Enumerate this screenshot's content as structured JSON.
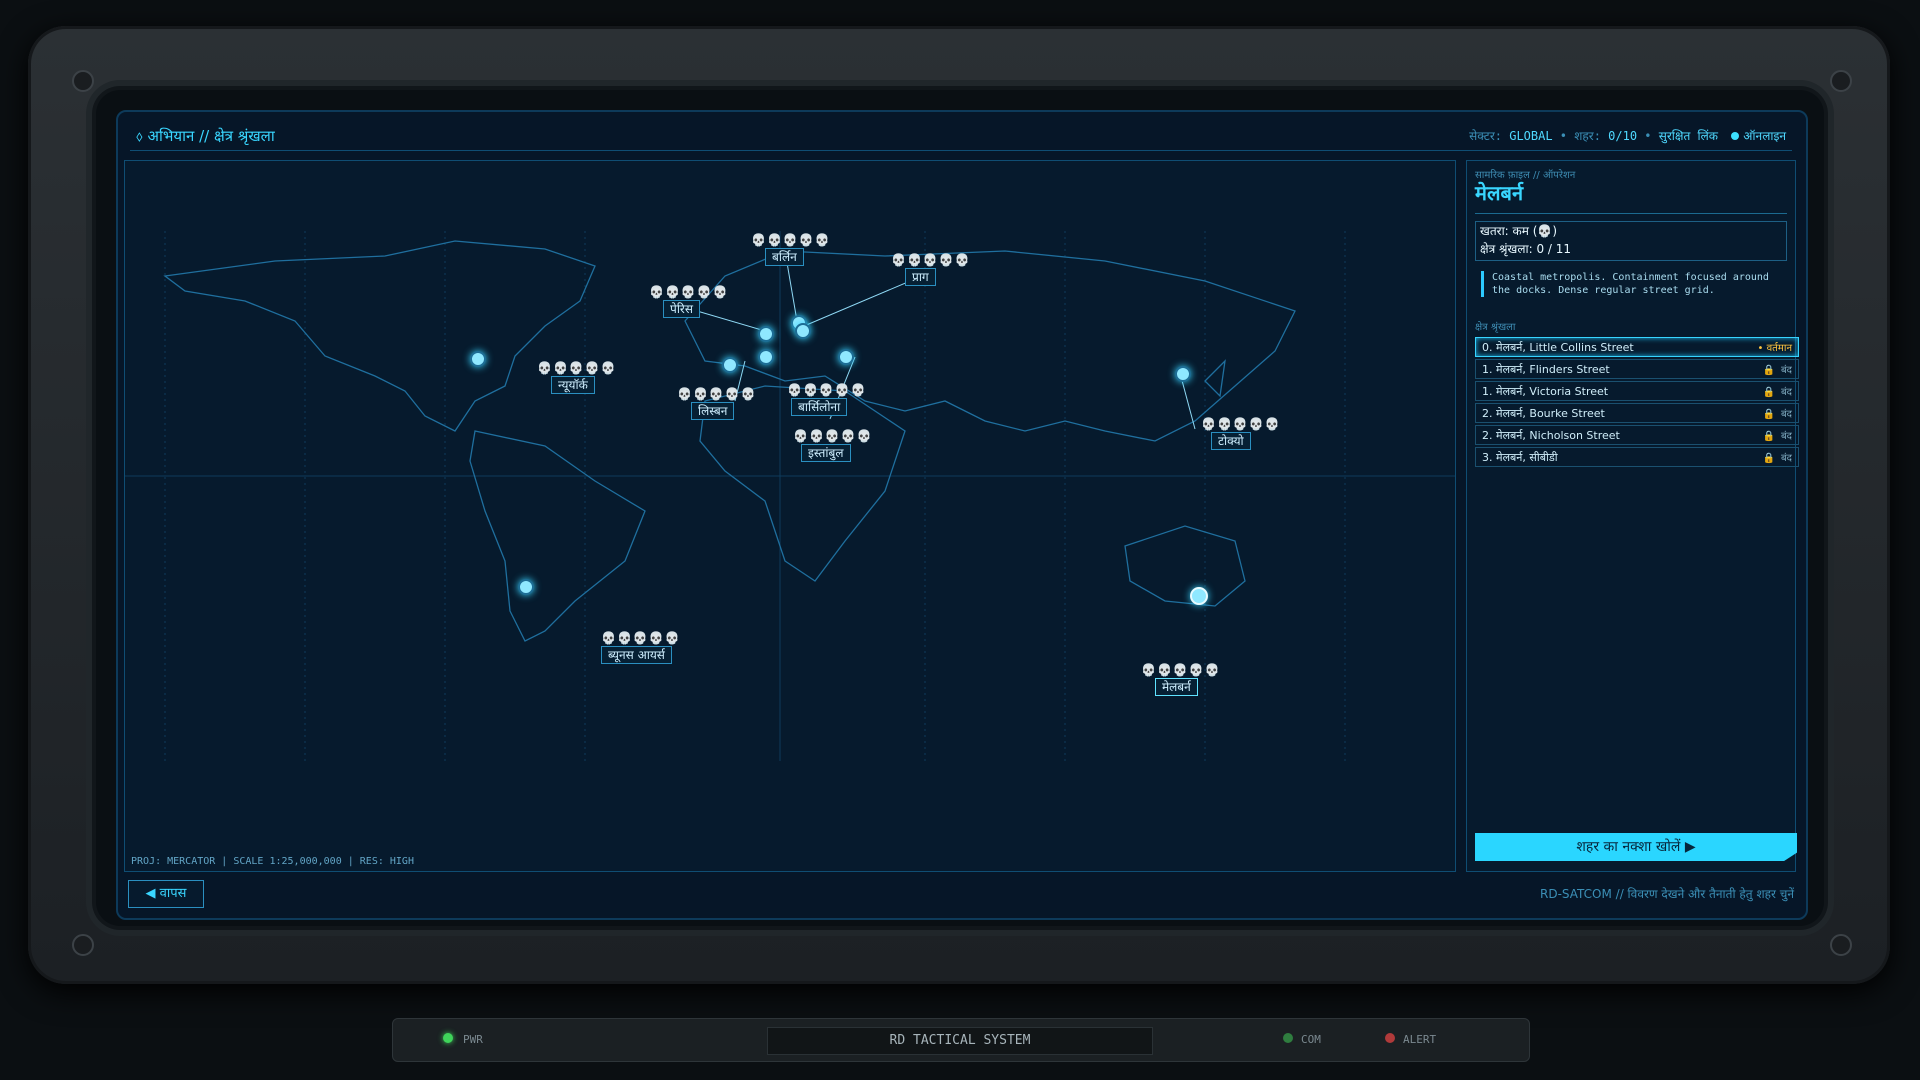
{
  "header": {
    "breadcrumb": "⬨ अभियान // क्षेत्र श्रृंखला",
    "sector_label": "सेक्टर:",
    "sector_value": "GLOBAL",
    "city_label": "शहर:",
    "city_value": "0/10",
    "link_label": "सुरक्षित लिंक",
    "online_label": "ऑनलाइन"
  },
  "map": {
    "footer_info": "PROJ: MERCATOR | SCALE 1:25,000,000 | RES: HIGH",
    "cities": [
      {
        "name": "बर्लिन",
        "threat_on": 2,
        "threat_off": 3
      },
      {
        "name": "पेरिस",
        "threat_on": 4,
        "threat_off": 1
      },
      {
        "name": "प्राग",
        "threat_on": 2,
        "threat_off": 3
      },
      {
        "name": "न्यूयॉर्क",
        "threat_on": 3,
        "threat_off": 2
      },
      {
        "name": "लिस्बन",
        "threat_on": 3,
        "threat_off": 2
      },
      {
        "name": "बार्सिलोना",
        "threat_on": 4,
        "threat_off": 1
      },
      {
        "name": "इस्तांबुल",
        "threat_on": 5,
        "threat_off": 0
      },
      {
        "name": "टोक्यो",
        "threat_on": 5,
        "threat_off": 0
      },
      {
        "name": "ब्यूनस आयर्स",
        "threat_on": 2,
        "threat_off": 3
      },
      {
        "name": "मेलबर्न",
        "threat_on": 1,
        "threat_off": 4
      }
    ]
  },
  "panel": {
    "subtitle": "सामरिक फ़ाइल // ऑपरेशन",
    "city_title": "मेलबर्न",
    "threat_line": "खतरा: कम (💀)",
    "chain_line": "क्षेत्र श्रृंखला: 0 / 11",
    "description": "Coastal metropolis. Containment focused around the docks. Dense regular street grid.",
    "section_label": "क्षेत्र श्रृंखला",
    "routes": [
      {
        "name": "0. मेलबर्न, Little Collins Street",
        "state": "• वर्तमान",
        "locked": false
      },
      {
        "name": "1. मेलबर्न, Flinders Street",
        "state": "बंद",
        "locked": true
      },
      {
        "name": "1. मेलबर्न, Victoria Street",
        "state": "बंद",
        "locked": true
      },
      {
        "name": "2. मेलबर्न, Bourke Street",
        "state": "बंद",
        "locked": true
      },
      {
        "name": "2. मेलबर्न, Nicholson Street",
        "state": "बंद",
        "locked": true
      },
      {
        "name": "3. मेलबर्न, सीबीडी",
        "state": "बंद",
        "locked": true
      }
    ],
    "cta": "शहर का नक्शा खोलें ▶"
  },
  "footer": {
    "back": "◀ वापस",
    "hint": "RD-SATCOM // विवरण देखने और तैनाती हेतु शहर चुनें"
  },
  "hud": {
    "pwr": "PWR",
    "title": "RD TACTICAL SYSTEM",
    "com": "COM",
    "alert": "ALERT",
    "colors": {
      "pwr": "#3fd45a",
      "com": "#2f7d3f",
      "alert": "#b03a3a"
    }
  }
}
